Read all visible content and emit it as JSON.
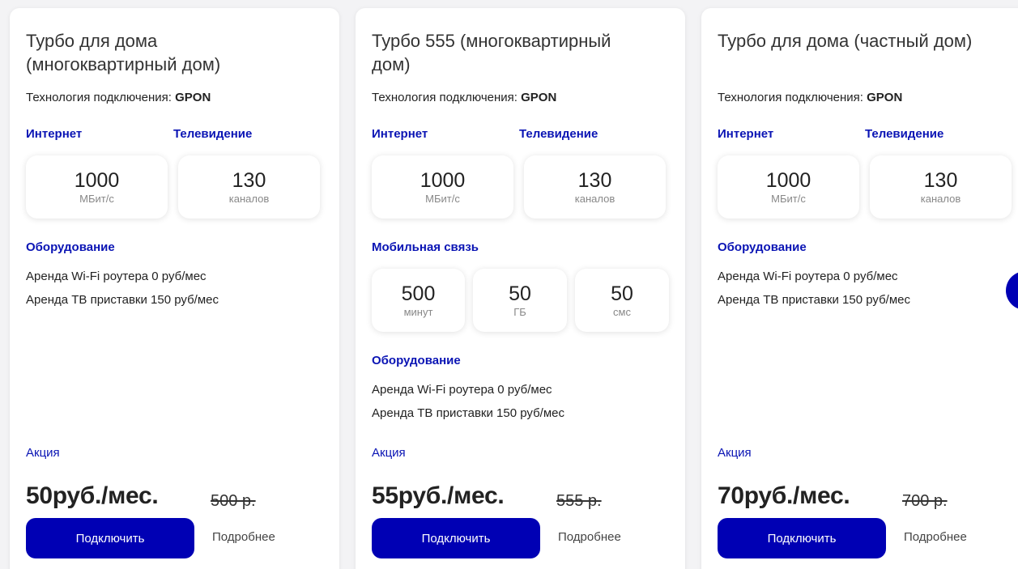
{
  "colors": {
    "accent": "#0a14b4",
    "button": "#0000b4",
    "card_bg": "#ffffff",
    "page_bg": "#f3f3f5"
  },
  "cards": [
    {
      "title": "Турбо для дома (многоквартирный дом)",
      "tech_label": "Технология подключения:",
      "tech_value": "GPON",
      "internet_label": "Интернет",
      "tv_label": "Телевидение",
      "internet_value": "1000",
      "internet_unit": "МБит/с",
      "tv_value": "130",
      "tv_unit": "каналов",
      "equipment_label": "Оборудование",
      "equipment": [
        "Аренда Wi-Fi роутера 0 руб/мес",
        "Аренда ТВ приставки 150 руб/мес"
      ],
      "promo_label": "Акция",
      "price": "50руб./мес.",
      "old_price": "500 р.",
      "connect_label": "Подключить",
      "more_label": "Подробнее"
    },
    {
      "title": "Турбо 555 (многоквартирный дом)",
      "tech_label": "Технология подключения:",
      "tech_value": "GPON",
      "internet_label": "Интернет",
      "tv_label": "Телевидение",
      "internet_value": "1000",
      "internet_unit": "МБит/с",
      "tv_value": "130",
      "tv_unit": "каналов",
      "mobile_label": "Мобильная связь",
      "mobile": [
        {
          "value": "500",
          "unit": "минут"
        },
        {
          "value": "50",
          "unit": "ГБ"
        },
        {
          "value": "50",
          "unit": "смс"
        }
      ],
      "equipment_label": "Оборудование",
      "equipment": [
        "Аренда Wi-Fi роутера 0 руб/мес",
        "Аренда ТВ приставки 150 руб/мес"
      ],
      "promo_label": "Акция",
      "price": "55руб./мес.",
      "old_price": "555 р.",
      "connect_label": "Подключить",
      "more_label": "Подробнее"
    },
    {
      "title": "Турбо для дома (частный дом)",
      "tech_label": "Технология подключения:",
      "tech_value": "GPON",
      "internet_label": "Интернет",
      "tv_label": "Телевидение",
      "internet_value": "1000",
      "internet_unit": "МБит/с",
      "tv_value": "130",
      "tv_unit": "каналов",
      "equipment_label": "Оборудование",
      "equipment": [
        "Аренда Wi-Fi роутера 0 руб/мес",
        "Аренда ТВ приставки 150 руб/мес"
      ],
      "promo_label": "Акция",
      "price": "70руб./мес.",
      "old_price": "700 р.",
      "connect_label": "Подключить",
      "more_label": "Подробнее"
    }
  ]
}
